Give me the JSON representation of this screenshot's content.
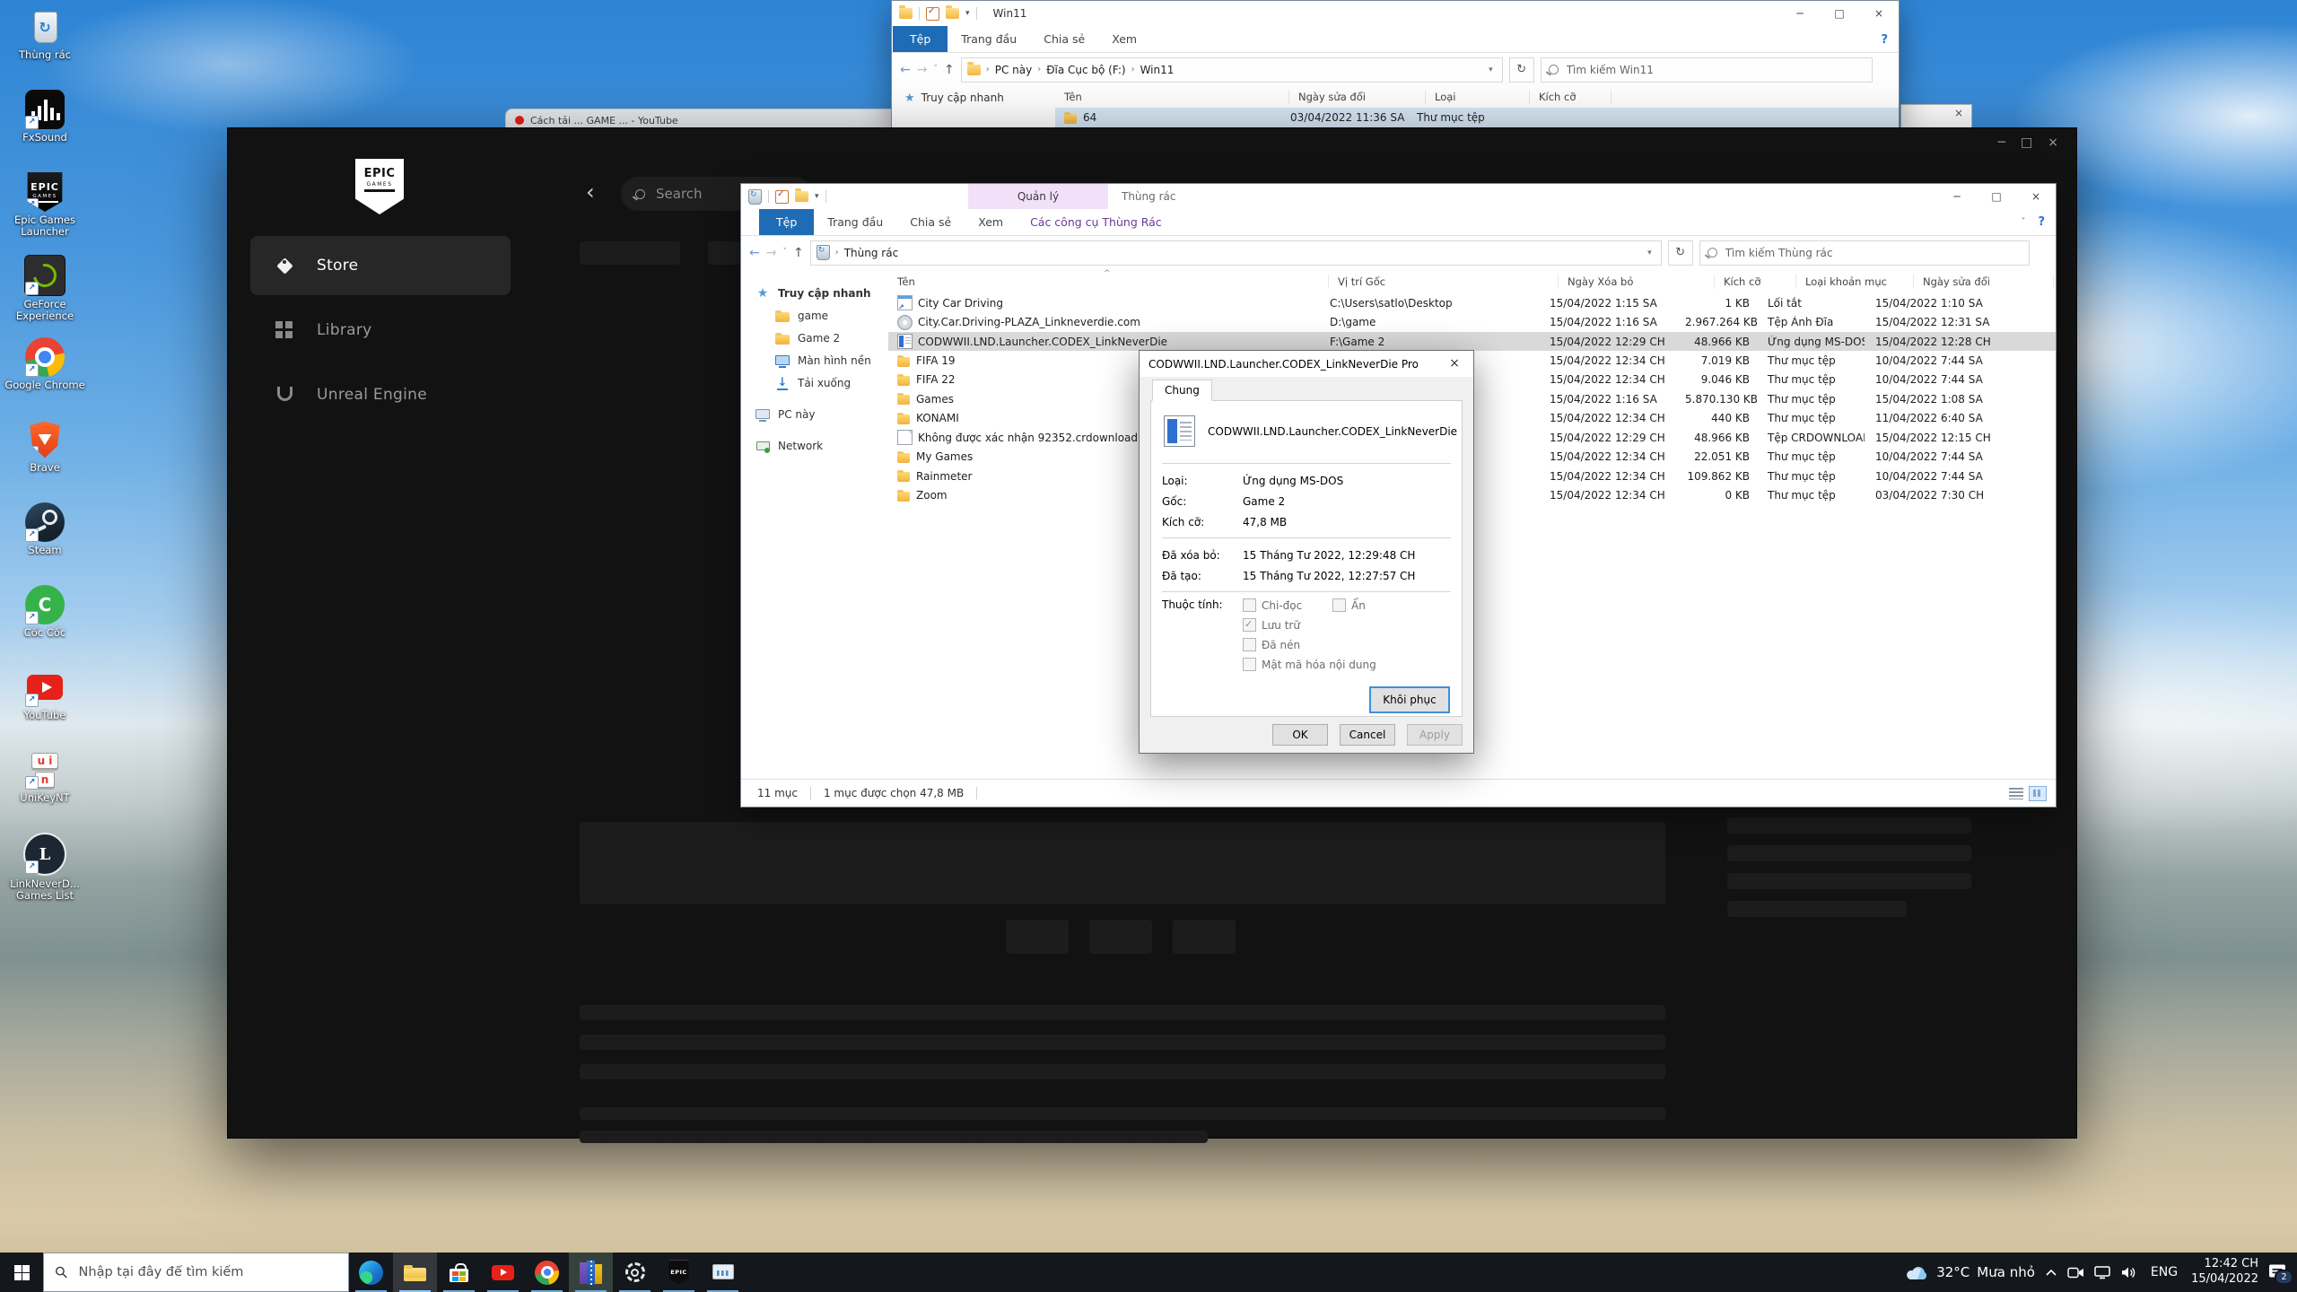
{
  "glyphs": {
    "back": "←",
    "forward": "→",
    "up": "↑",
    "caret": "˅",
    "dropdown": "▾",
    "refresh": "↻",
    "sort": "^",
    "crumb": "›",
    "min": "─",
    "max": "□",
    "close": "×",
    "help": "?",
    "collapse": "˅",
    "epic_back": "‹"
  },
  "fragments": {
    "browser_title": "Cách tải ... GAME ... - YouTube",
    "close": "×"
  },
  "desktop": {
    "icons": [
      {
        "glyph": "g-recycle",
        "label": "Thùng rác",
        "name": "recycle-bin-desktop-icon"
      },
      {
        "glyph": "g-fxsound",
        "label": "FxSound",
        "shortcut": "sc",
        "name": "fxsound-desktop-icon"
      },
      {
        "glyph": "g-epic",
        "label": "Epic Games Launcher",
        "gtext": "EPIC",
        "gtext2": "GAMES",
        "shortcut": "sc",
        "name": "epic-games-launcher-desktop-icon"
      },
      {
        "glyph": "g-geforce",
        "label": "GeForce Experience",
        "shortcut": "sc",
        "name": "geforce-experience-desktop-icon"
      },
      {
        "glyph": "g-chrome",
        "label": "Google Chrome",
        "shortcut": "sc",
        "name": "google-chrome-desktop-icon"
      },
      {
        "glyph": "g-brave",
        "label": "Brave",
        "shortcut": "sc",
        "name": "brave-desktop-icon"
      },
      {
        "glyph": "g-steam",
        "label": "Steam",
        "shortcut": "sc",
        "name": "steam-desktop-icon"
      },
      {
        "glyph": "g-coccoc",
        "label": "Cốc Cốc",
        "gtext": "C",
        "shortcut": "sc",
        "name": "coc-coc-desktop-icon"
      },
      {
        "glyph": "g-youtube",
        "label": "YouTube",
        "shortcut": "sc",
        "name": "youtube-desktop-icon"
      },
      {
        "glyph": "g-unikey",
        "label": "UniKeyNT",
        "gtext": "u i",
        "gtext2": "n",
        "shortcut": "sc",
        "name": "unikey-desktop-icon"
      },
      {
        "glyph": "g-lnd",
        "label": "LinkNeverD... Games List",
        "gtext": "L",
        "shortcut": "sc",
        "name": "lnd-games-list-desktop-icon"
      }
    ]
  },
  "win11": {
    "title": "Win11",
    "menu": [
      {
        "label": "Tệp",
        "cls": "file",
        "name": "tab-file"
      },
      {
        "label": "Trang đầu",
        "name": "tab-home"
      },
      {
        "label": "Chia sẻ",
        "name": "tab-share"
      },
      {
        "label": "Xem",
        "name": "tab-view"
      }
    ],
    "crumb1": "PC này",
    "crumb2": "Đĩa Cục bộ (F:)",
    "crumb3": "Win11",
    "search_placeholder": "Tìm kiếm Win11",
    "quick_access": "Truy cập nhanh",
    "columns": {
      "name": "Tên",
      "modified": "Ngày sửa đổi",
      "type": "Loại",
      "size": "Kích cỡ"
    },
    "row": {
      "name": "64",
      "modified": "03/04/2022 11:36 SA",
      "type": "Thư mục tệp"
    }
  },
  "epic": {
    "logo1": "EPIC",
    "logo2": "GAMES",
    "search_placeholder": "Search",
    "nav": [
      {
        "label": "Store",
        "icon": "ei-store",
        "cls": "sel",
        "name": "sidebar-item-store"
      },
      {
        "label": "Library",
        "icon": "ei-library",
        "name": "sidebar-item-library"
      },
      {
        "label": "Unreal Engine",
        "icon": "ei-unreal",
        "name": "sidebar-item-unreal-engine"
      }
    ]
  },
  "recycle": {
    "contextual": "Quản lý",
    "title": "Thùng rác",
    "tabs": [
      {
        "label": "Tệp",
        "cls": "file",
        "name": "tab-file"
      },
      {
        "label": "Trang đầu",
        "name": "tab-home"
      },
      {
        "label": "Chia sẻ",
        "name": "tab-share"
      },
      {
        "label": "Xem",
        "name": "tab-view"
      },
      {
        "label": "Các công cụ Thùng Rác",
        "cls": "ctx",
        "name": "tab-recycle-tools"
      }
    ],
    "breadcrumb": "Thùng rác",
    "search_placeholder": "Tìm kiếm Thùng rác",
    "sidebar": [
      {
        "label": "Truy cập nhanh",
        "icon": "si-star",
        "cls": "lvl0 sel",
        "name": "sidebar-item-quick-access"
      },
      {
        "label": "game",
        "icon": "si-folder",
        "cls": "lvl1",
        "name": "sidebar-item-game"
      },
      {
        "label": "Game 2",
        "icon": "si-folder",
        "cls": "lvl1",
        "name": "sidebar-item-game-2"
      },
      {
        "label": "Màn hình nền",
        "icon": "si-desktop",
        "cls": "lvl1",
        "name": "sidebar-item-desktop"
      },
      {
        "label": "Tải xuống",
        "icon": "si-down",
        "cls": "lvl1",
        "name": "sidebar-item-downloads"
      },
      {
        "label": "PC này",
        "icon": "si-pc",
        "cls": "lvl0 gap",
        "name": "sidebar-item-this-pc"
      },
      {
        "label": "Network",
        "icon": "si-net",
        "cls": "lvl0 gap",
        "name": "sidebar-item-network"
      }
    ],
    "columns": {
      "name": "Tên",
      "location": "Vị trí Gốc",
      "deleted": "Ngày Xóa bỏ",
      "size": "Kích cỡ",
      "type": "Loại khoản mục",
      "modified": "Ngày sửa đổi"
    },
    "rows": [
      {
        "name": "City Car Driving",
        "icon": "fi-shortcut",
        "location": "C:\\Users\\satlo\\Desktop",
        "deleted": "15/04/2022 1:15 SA",
        "size": "1 KB",
        "type": "Lối tắt",
        "modified": "15/04/2022 1:10 SA"
      },
      {
        "name": "City.Car.Driving-PLAZA_Linkneverdie.com",
        "icon": "fi-disc",
        "location": "D:\\game",
        "deleted": "15/04/2022 1:16 SA",
        "size": "2.967.264 KB",
        "type": "Tệp Ảnh Đĩa",
        "modified": "15/04/2022 12:31 SA"
      },
      {
        "name": "CODWWII.LND.Launcher.CODEX_LinkNeverDie",
        "icon": "fi-msdos",
        "location": "F:\\Game 2",
        "deleted": "15/04/2022 12:29 CH",
        "size": "48.966 KB",
        "type": "Ứng dụng MS-DOS",
        "modified": "15/04/2022 12:28 CH",
        "cls": "sel"
      },
      {
        "name": "FIFA 19",
        "icon": "fi-folder",
        "location": "",
        "deleted": "15/04/2022 12:34 CH",
        "size": "7.019 KB",
        "type": "Thư mục tệp",
        "modified": "10/04/2022 7:44 SA"
      },
      {
        "name": "FIFA 22",
        "icon": "fi-folder",
        "location": "",
        "deleted": "15/04/2022 12:34 CH",
        "size": "9.046 KB",
        "type": "Thư mục tệp",
        "modified": "10/04/2022 7:44 SA"
      },
      {
        "name": "Games",
        "icon": "fi-folder",
        "location": "",
        "deleted": "15/04/2022 1:16 SA",
        "size": "5.870.130 KB",
        "type": "Thư mục tệp",
        "modified": "15/04/2022 1:08 SA"
      },
      {
        "name": "KONAMI",
        "icon": "fi-folder",
        "location": "",
        "deleted": "15/04/2022 12:34 CH",
        "size": "440 KB",
        "type": "Thư mục tệp",
        "modified": "11/04/2022 6:40 SA"
      },
      {
        "name": "Không được xác nhận 92352.crdownload",
        "icon": "fi-file",
        "location": "",
        "deleted": "15/04/2022 12:29 CH",
        "size": "48.966 KB",
        "type": "Tệp CRDOWNLOAD",
        "modified": "15/04/2022 12:15 CH"
      },
      {
        "name": "My Games",
        "icon": "fi-folder",
        "location": "",
        "deleted": "15/04/2022 12:34 CH",
        "size": "22.051 KB",
        "type": "Thư mục tệp",
        "modified": "10/04/2022 7:44 SA"
      },
      {
        "name": "Rainmeter",
        "icon": "fi-folder",
        "location": "",
        "deleted": "15/04/2022 12:34 CH",
        "size": "109.862 KB",
        "type": "Thư mục tệp",
        "modified": "10/04/2022 7:44 SA"
      },
      {
        "name": "Zoom",
        "icon": "fi-folder",
        "location": "",
        "deleted": "15/04/2022 12:34 CH",
        "size": "0 KB",
        "type": "Thư mục tệp",
        "modified": "03/04/2022 7:30 CH"
      }
    ],
    "status_items": "11 mục",
    "status_selected": "1 mục được chọn  47,8 MB"
  },
  "dialog": {
    "title": "CODWWII.LND.Launcher.CODEX_LinkNeverDie Properties",
    "tab": "Chung",
    "file_name": "CODWWII.LND.Launcher.CODEX_LinkNeverDie",
    "fields": {
      "type_label": "Loại:",
      "type": "Ứng dụng MS-DOS",
      "origin_label": "Gốc:",
      "origin": "Game 2",
      "size_label": "Kích cỡ:",
      "size": "47,8 MB",
      "deleted_label": "Đã xóa bỏ:",
      "deleted": "15 Tháng Tư 2022, 12:29:48 CH",
      "created_label": "Đã tạo:",
      "created": "15 Tháng Tư 2022, 12:27:57 CH",
      "attrs_label": "Thuộc tính:"
    },
    "attributes": [
      {
        "label": "Chi-đọc",
        "cls": "w1",
        "name": "checkbox-read-only"
      },
      {
        "label": "Ẩn",
        "cls": "w2",
        "name": "checkbox-hidden"
      },
      {
        "label": "Lưu trữ",
        "cls": "wfull",
        "checked": "on",
        "name": "checkbox-archive"
      },
      {
        "label": "Đã nén",
        "cls": "wfull",
        "name": "checkbox-compressed"
      },
      {
        "label": "Mật mã hóa nội dung",
        "cls": "wfull",
        "name": "checkbox-encrypt"
      }
    ],
    "restore": "Khôi phục",
    "ok": "OK",
    "cancel": "Cancel",
    "apply": "Apply"
  },
  "taskbar": {
    "search_placeholder": "Nhập tại đây để tìm kiếm",
    "icons": [
      {
        "glyph": "tb-edge",
        "name": "edge-taskbar-icon"
      },
      {
        "glyph": "tb-explorer",
        "cls": "active",
        "name": "file-explorer-taskbar-icon"
      },
      {
        "glyph": "tb-store",
        "name": "microsoft-store-taskbar-icon"
      },
      {
        "glyph": "tb-youtube",
        "name": "youtube-taskbar-icon"
      },
      {
        "glyph": "tb-chrome",
        "name": "chrome-taskbar-icon"
      },
      {
        "glyph": "tb-winrar",
        "cls": "hilite",
        "name": "winrar-taskbar-icon"
      },
      {
        "glyph": "tb-gear",
        "name": "settings-taskbar-icon"
      },
      {
        "glyph": "tb-epic",
        "gtext": "EPIC",
        "name": "epic-games-taskbar-icon"
      },
      {
        "glyph": "tb-taskmgr",
        "name": "task-manager-taskbar-icon"
      }
    ],
    "tray": {
      "temp": "32°C",
      "weather": "Mưa nhỏ",
      "lang": "ENG",
      "time": "12:42 CH",
      "date": "15/04/2022",
      "badge": "2"
    }
  }
}
